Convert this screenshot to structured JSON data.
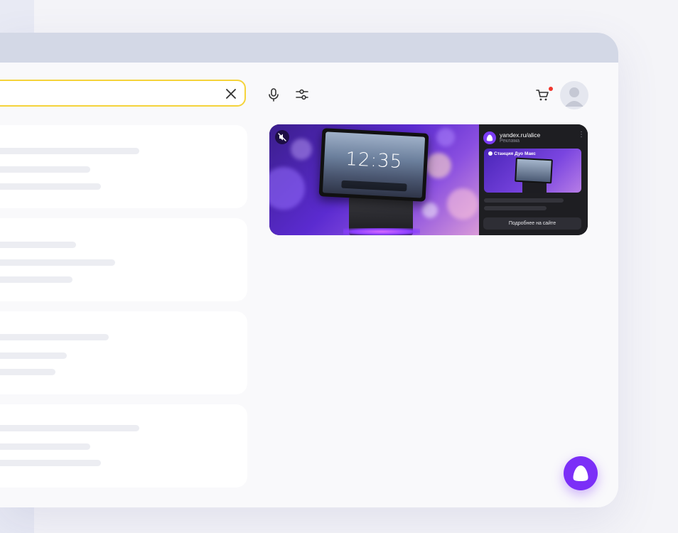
{
  "search": {
    "value": "",
    "clear_icon": "close-icon"
  },
  "toolbar": {
    "mic_icon": "microphone-icon",
    "filter_icon": "filter-sliders-icon",
    "cart_icon": "cart-icon",
    "cart_badge_color": "#f0372e",
    "avatar_icon": "user-avatar-icon"
  },
  "results": [
    {
      "kind": "skeleton"
    },
    {
      "kind": "skeleton"
    },
    {
      "kind": "skeleton"
    },
    {
      "kind": "skeleton"
    }
  ],
  "ad": {
    "domain": "yandex.ru/alice",
    "label": "Реклама",
    "clock": "12:35",
    "thumb_title": "Станция Дуо Макс",
    "cta_label": "Подробнее на сайте",
    "mute_icon": "muted-speaker-icon",
    "menu_icon": "more-vertical-icon"
  },
  "alice_button": {
    "icon": "alice-icon",
    "color": "#7b2ff7"
  },
  "colors": {
    "search_border": "#f5d33b",
    "titlebar": "#d3d8e6",
    "accent": "#7b2ff7"
  }
}
